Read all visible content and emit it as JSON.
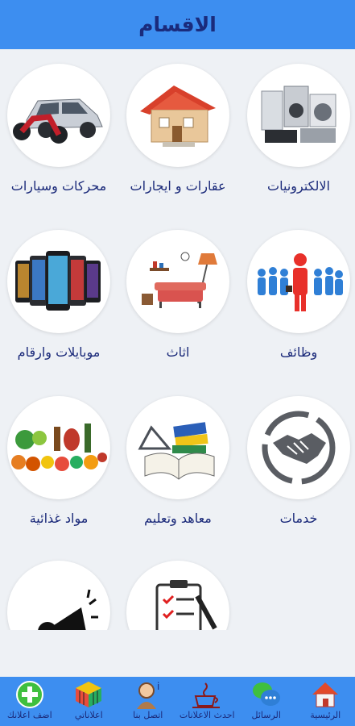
{
  "header": {
    "title": "الاقسام"
  },
  "categories": [
    {
      "label": "الالكترونيات",
      "icon": "electronics-icon"
    },
    {
      "label": "عقارات و ايجارات",
      "icon": "house-icon"
    },
    {
      "label": "محركات وسيارات",
      "icon": "car-motorcycle-icon"
    },
    {
      "label": "وظائف",
      "icon": "team-leader-icon"
    },
    {
      "label": "اثاث",
      "icon": "furniture-icon"
    },
    {
      "label": "موبايلات وارقام",
      "icon": "mobile-phones-icon"
    },
    {
      "label": "خدمات",
      "icon": "handshake-icon"
    },
    {
      "label": "معاهد وتعليم",
      "icon": "books-icon"
    },
    {
      "label": "مواد غذائية",
      "icon": "groceries-icon"
    },
    {
      "label": "",
      "icon": "megaphone-icon"
    },
    {
      "label": "",
      "icon": "clipboard-checklist-icon"
    }
  ],
  "bottom_nav": [
    {
      "label": "الرئيسية",
      "icon": "home-icon"
    },
    {
      "label": "الرسائل",
      "icon": "chat-bubbles-icon"
    },
    {
      "label": "احدث الاعلانات",
      "icon": "coffee-cup-icon"
    },
    {
      "label": "اتصل بنا",
      "icon": "contact-person-icon"
    },
    {
      "label": "اعلاناتي",
      "icon": "rubik-cube-icon"
    },
    {
      "label": "اضف اعلانك",
      "icon": "add-plus-icon"
    }
  ],
  "colors": {
    "header": "#3d8ef0",
    "label_text": "#1b2a7a",
    "background": "#eef1f5"
  }
}
